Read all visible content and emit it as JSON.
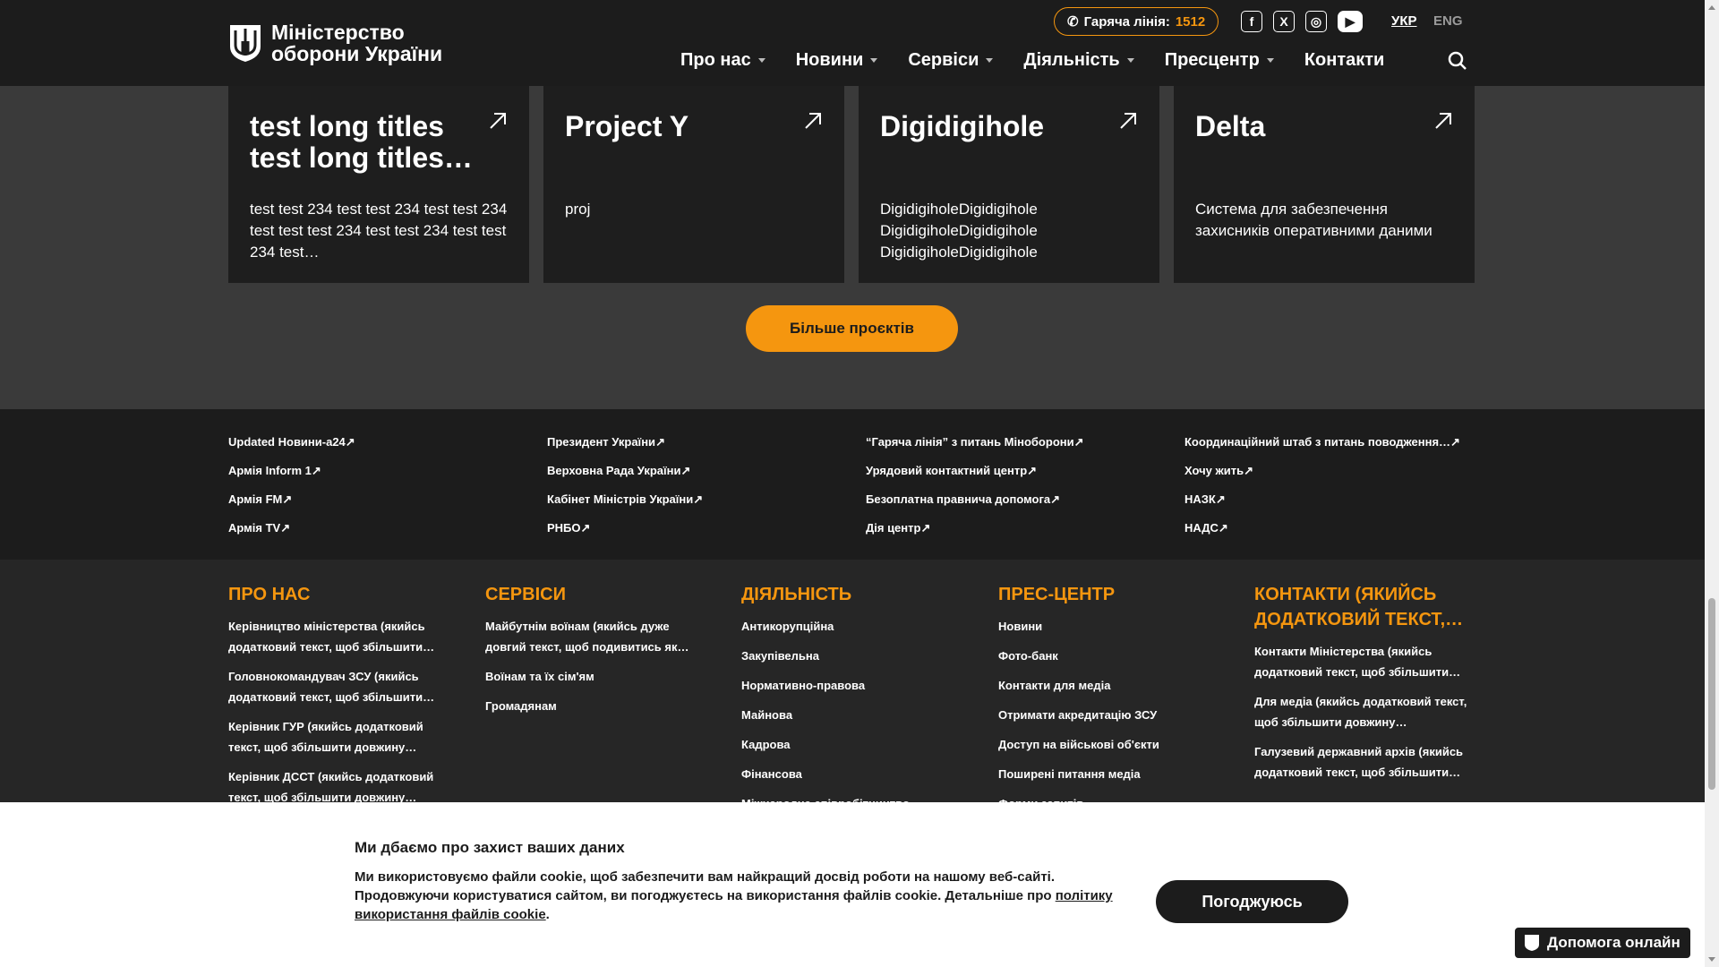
{
  "header": {
    "logo_line1": "Міністерство",
    "logo_line2": "оборони України",
    "hotline_label": "Гаряча лінія:",
    "hotline_number": "1512",
    "socials": [
      "facebook-icon",
      "x-icon",
      "instagram-icon",
      "youtube-icon"
    ],
    "lang_active": "УКР",
    "lang_other": "ENG",
    "nav": [
      "Про нас",
      "Новини",
      "Сервіси",
      "Діяльність",
      "Пресцентр",
      "Контакти"
    ]
  },
  "projects": [
    {
      "title": "test long titles test long titles…",
      "desc": "test test 234 test test 234 test test 234 test test test 234 test test 234 test test 234 test…"
    },
    {
      "title": "Project Y",
      "desc": "proj"
    },
    {
      "title": "Digidigihole",
      "desc": "DigidigiholeDigidigihole DigidigiholeDigidigihole DigidigiholeDigidigihole"
    },
    {
      "title": "Delta",
      "desc": "Система для забезпечення захисників оперативними даними"
    }
  ],
  "more_button": "Більше проєктів",
  "external_links": [
    [
      "Updated Новини-a24",
      "Армія Inform 1",
      "Армія FM",
      "Армія TV"
    ],
    [
      "Президент України",
      "Верховна Рада України",
      "Кабінет Міністрів України",
      "РНБО"
    ],
    [
      "“Гаряча лінія” з питань Міноборони",
      "Урядовий контактний центр",
      "Безоплатна правнича допомога",
      "Дія центр"
    ],
    [
      "Координаційний штаб з питань поводження…",
      "Хочу жить",
      "НАЗК",
      "НАДС"
    ]
  ],
  "footer": [
    {
      "title": "ПРО НАС",
      "items": [
        "Керівництво міністерства (якийсь додатковий текст, щоб збільшити…",
        "Головнокомандувач ЗСУ (якийсь додатковий текст, щоб збільшити…",
        "Керівник ГУР (якийсь додатковий текст, щоб збільшити довжину…",
        "Керівник ДССТ (якийсь додатковий текст, щоб збільшити довжину…"
      ]
    },
    {
      "title": "СЕРВІСИ",
      "items": [
        "Майбутнім воїнам (якийсь дуже довгий текст, щоб подивитись як…",
        "Воїнам та їх сім'ям",
        "Громадянам"
      ]
    },
    {
      "title": "ДІЯЛЬНІСТЬ",
      "items": [
        "Антикорупційна",
        "Закупівельна",
        "Нормативно-правова",
        "Майнова",
        "Кадрова",
        "Фінансова",
        "Міжнародне співробітництво"
      ]
    },
    {
      "title": "ПРЕС-ЦЕНТР",
      "items": [
        "Новини",
        "Фото-банк",
        "Контакти для медіа",
        "Отримати акредитацію ЗСУ",
        "Доступ на військові об'єкти",
        "Поширені питання медіа",
        "Форми запитів"
      ]
    },
    {
      "title": "КОНТАКТИ (ЯКИЙСЬ ДОДАТКОВИЙ ТЕКСТ,…",
      "items": [
        "Контакти Міністерства (якийсь додатковий текст, щоб збільшити…",
        "Для медіа (якийсь додатковий текст, щоб збільшити довжину…",
        "Галузевий державний архів (якийсь додатковий текст, щоб збільшити…"
      ]
    }
  ],
  "cookie": {
    "title": "Ми дбаємо про захист ваших даних",
    "text": "Ми використовуємо файли cookie, щоб забезпечити вам найкращий досвід роботи на нашому веб-сайті. Продовжуючи користуватися сайтом, ви погоджуєтесь на використання файлів cookie. Детальніше про ",
    "link": "політику використання файлів cookie",
    "tail": ".",
    "button": "Погоджуюсь"
  },
  "help_button": "Допомога онлайн",
  "colors": {
    "accent": "#f5960f",
    "dark": "#1c1c1c",
    "panel": "#3a3a3a"
  }
}
